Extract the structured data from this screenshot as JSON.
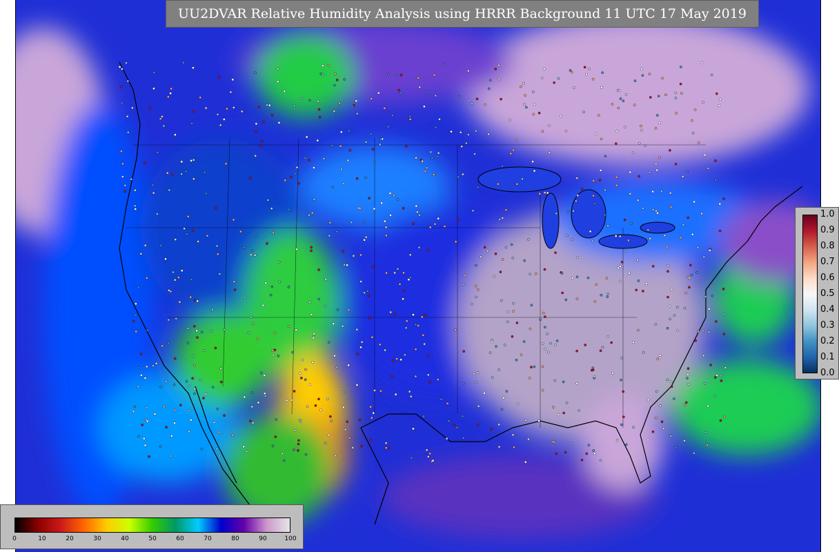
{
  "title": "UU2DVAR Relative Humidity Analysis using HRRR Background 11 UTC 17 May 2019",
  "ratio_colorbar": {
    "ticks": [
      "1.0",
      "0.9",
      "0.8",
      "0.7",
      "0.6",
      "0.5",
      "0.4",
      "0.3",
      "0.2",
      "0.1",
      "0.0"
    ],
    "colors": [
      "#67001f",
      "#b2182b",
      "#d6604d",
      "#f4a582",
      "#fddbc7",
      "#f7f7f7",
      "#d1e5f0",
      "#92c5de",
      "#4393c3",
      "#2166ac",
      "#053061"
    ]
  },
  "rh_colorbar": {
    "ticks": [
      "0",
      "10",
      "20",
      "30",
      "40",
      "50",
      "60",
      "70",
      "80",
      "90",
      "100"
    ],
    "colors": [
      "#000000",
      "#8b0000",
      "#cc1a1a",
      "#ff6600",
      "#ffcc00",
      "#ccff00",
      "#33cc00",
      "#009966",
      "#00ccff",
      "#0000cc",
      "#6600aa",
      "#cc99cc",
      "#e6e6e6"
    ]
  }
}
